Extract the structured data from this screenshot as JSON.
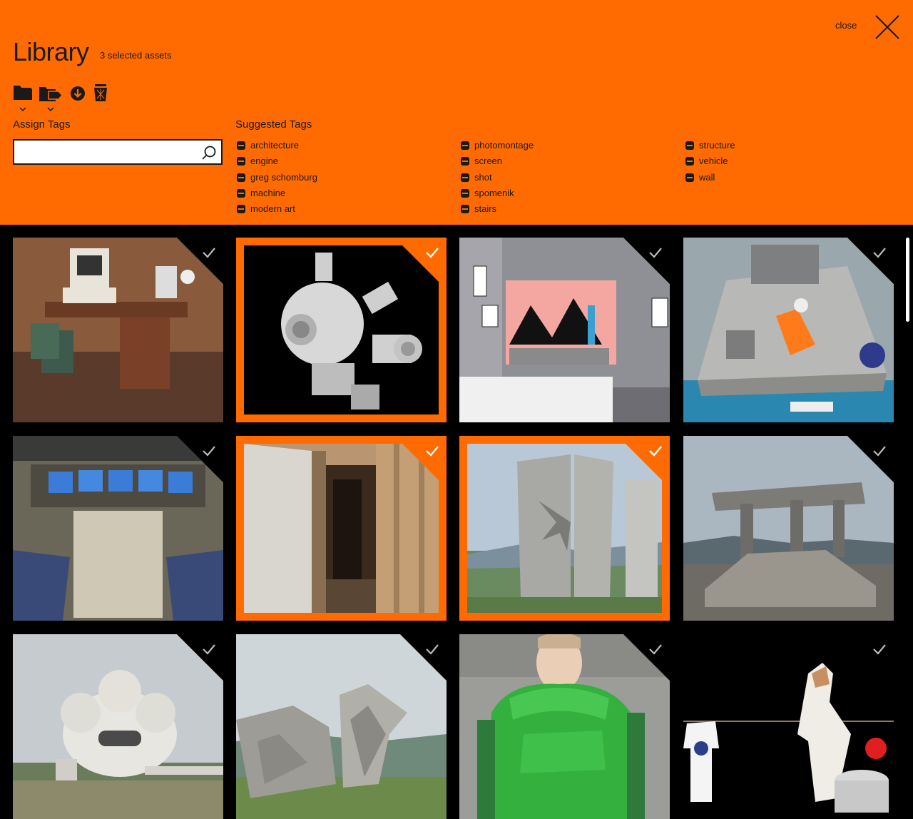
{
  "header": {
    "title": "Library",
    "selection_count": "3 selected assets",
    "close_label": "close",
    "accent_color": "#ff6b00"
  },
  "toolbar": {
    "icons": [
      "folder-icon",
      "tag-folder-icon",
      "download-icon",
      "trash-icon"
    ]
  },
  "assign_tags": {
    "label": "Assign Tags",
    "value": "",
    "placeholder": ""
  },
  "suggested_tags": {
    "label": "Suggested Tags",
    "col1": [
      "architecture",
      "engine",
      "greg schomburg",
      "machine",
      "modern art"
    ],
    "col2": [
      "photomontage",
      "screen",
      "shot",
      "spomenik",
      "stairs"
    ],
    "col3": [
      "structure",
      "vehicle",
      "wall"
    ]
  },
  "assets": [
    {
      "subject": "retro computer desk",
      "selected": false
    },
    {
      "subject": "white spherical machine",
      "selected": true
    },
    {
      "subject": "abstract painting on wall",
      "selected": false
    },
    {
      "subject": "space capsule in water",
      "selected": false
    },
    {
      "subject": "shuttle cockpit",
      "selected": false
    },
    {
      "subject": "wooden corridor",
      "selected": true
    },
    {
      "subject": "concrete monument",
      "selected": true
    },
    {
      "subject": "ruined structure",
      "selected": false
    },
    {
      "subject": "white modernist building",
      "selected": false
    },
    {
      "subject": "concrete wing sculpture",
      "selected": false
    },
    {
      "subject": "green puffer jacket",
      "selected": false
    },
    {
      "subject": "jumping cat",
      "selected": false
    }
  ]
}
